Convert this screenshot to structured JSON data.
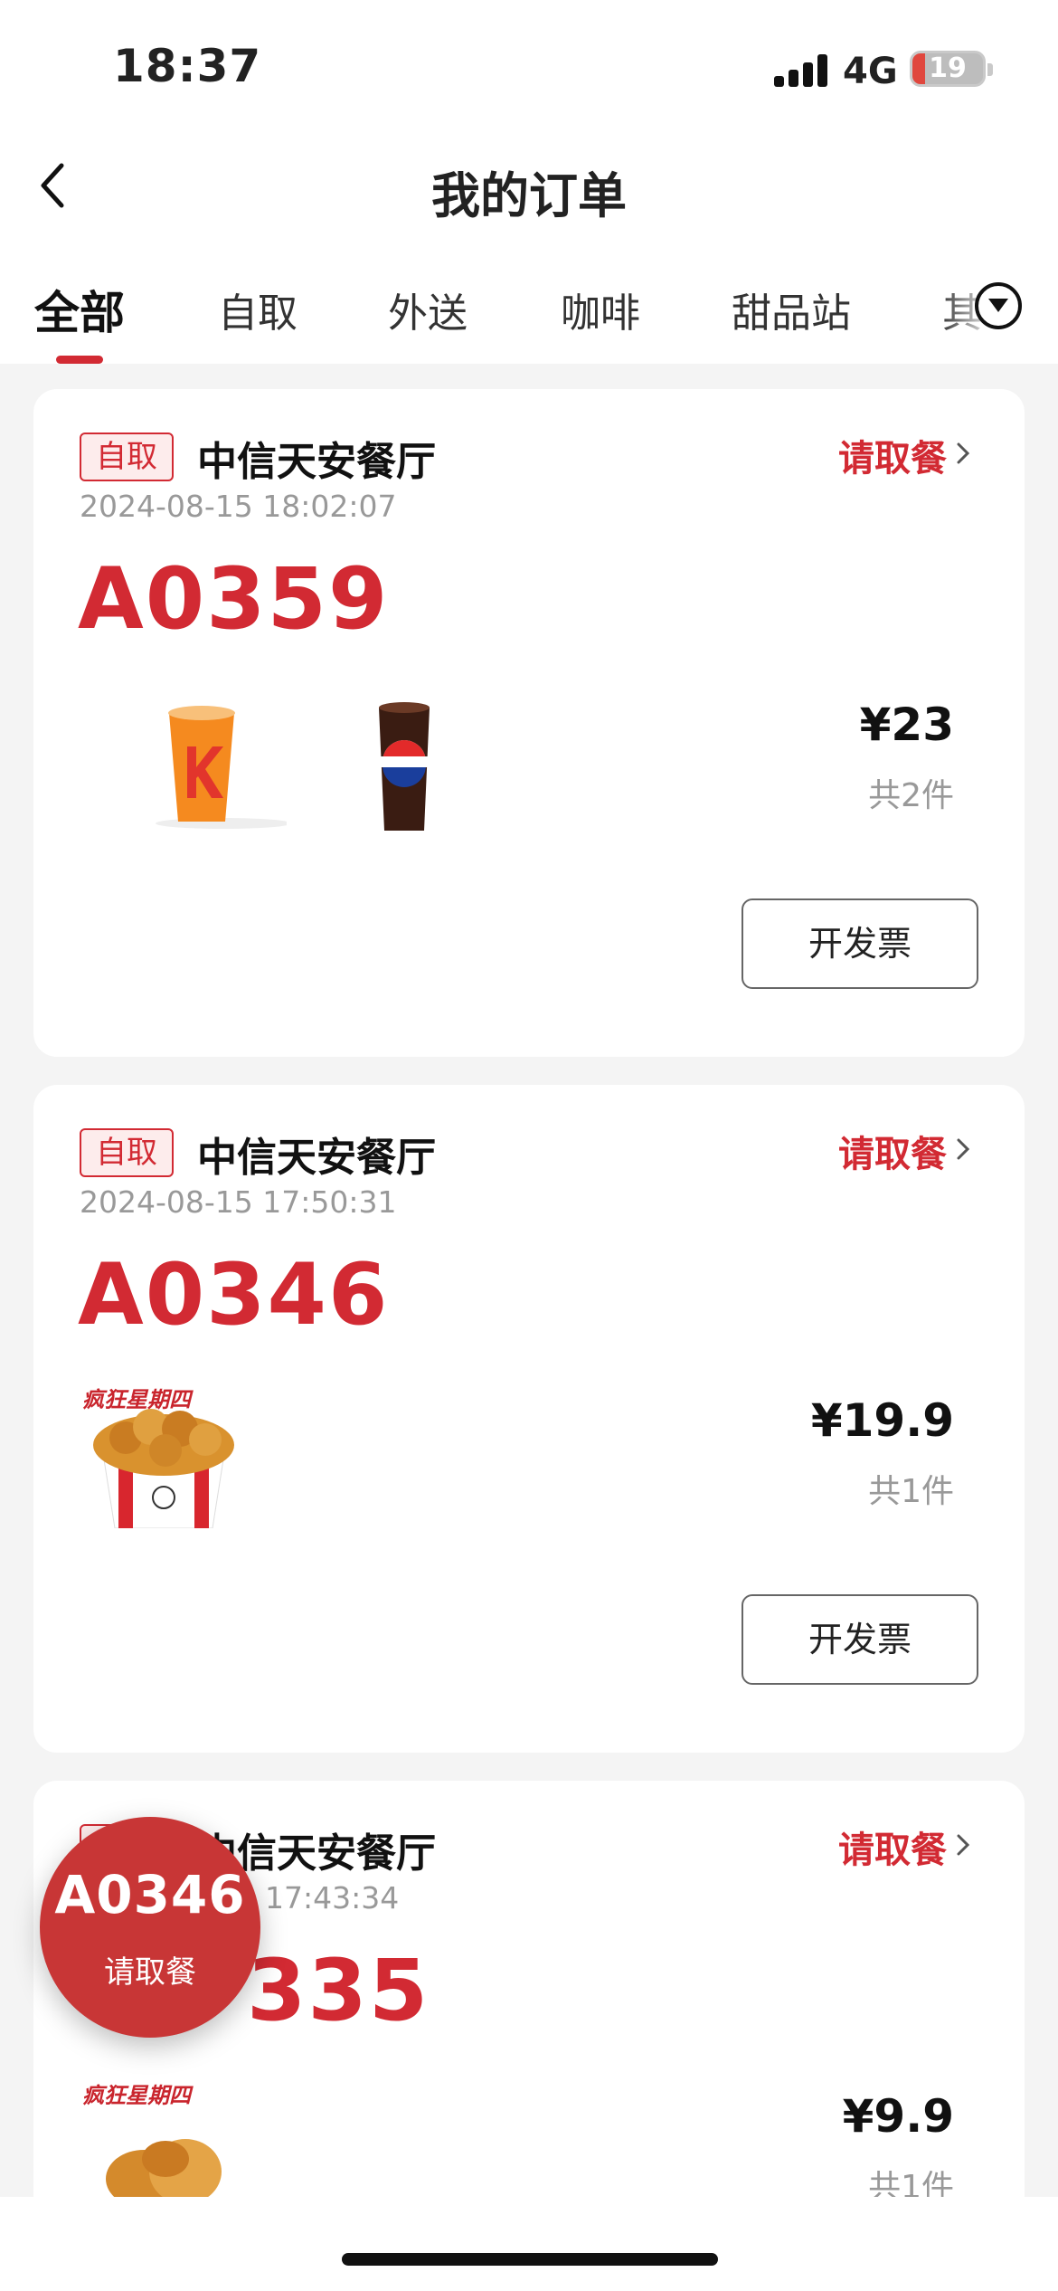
{
  "status_bar": {
    "time": "18:37",
    "network": "4G",
    "battery": "19"
  },
  "header": {
    "title": "我的订单"
  },
  "tabs": [
    {
      "label": "全部",
      "active": true
    },
    {
      "label": "自取"
    },
    {
      "label": "外送"
    },
    {
      "label": "咖啡"
    },
    {
      "label": "甜品站"
    },
    {
      "label": "其"
    }
  ],
  "orders": [
    {
      "type_badge": "自取",
      "store": "中信天安餐厅",
      "status": "请取餐",
      "datetime": "2024-08-15 18:02:07",
      "code": "A0359",
      "price": "¥23",
      "count": "共2件",
      "items": [
        "orange-k-drink-image",
        "pepsi-cup-image"
      ],
      "invoice_label": "开发票"
    },
    {
      "type_badge": "自取",
      "store": "中信天安餐厅",
      "status": "请取餐",
      "datetime": "2024-08-15 17:50:31",
      "code": "A0346",
      "price": "¥19.9",
      "count": "共1件",
      "items": [
        "crazy-thursday-chicken-bucket-image"
      ],
      "invoice_label": "开发票"
    },
    {
      "type_badge": "自取",
      "store": "中信天安餐厅",
      "status": "请取餐",
      "datetime": "17:43:34",
      "code": "A0335",
      "code_visible": "335",
      "price": "¥9.9",
      "count": "共1件",
      "items": [
        "crazy-thursday-fried-chicken-image"
      ]
    }
  ],
  "floating_pickup": {
    "code": "A0346",
    "label": "请取餐"
  },
  "colors": {
    "accent": "#d22a33",
    "float": "#c83636",
    "muted": "#999999",
    "page_bg": "#f4f4f4"
  }
}
